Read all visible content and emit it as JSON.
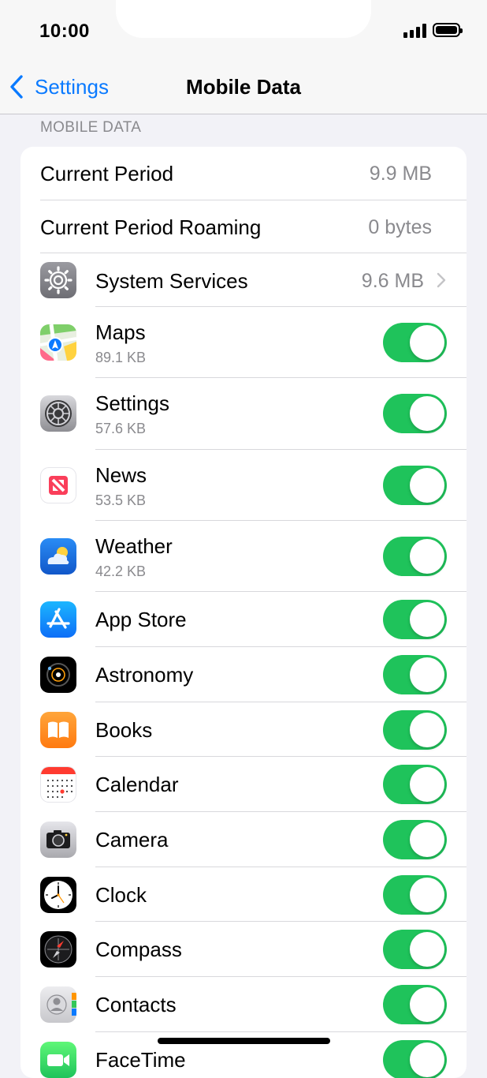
{
  "status_bar": {
    "time": "10:00"
  },
  "nav": {
    "back_label": "Settings",
    "title": "Mobile Data"
  },
  "section_header": "MOBILE DATA",
  "summary": {
    "current_period_label": "Current Period",
    "current_period_value": "9.9 MB",
    "roaming_label": "Current Period Roaming",
    "roaming_value": "0 bytes",
    "system_services_label": "System Services",
    "system_services_value": "9.6 MB"
  },
  "apps": [
    {
      "name": "Maps",
      "usage": "89.1 KB",
      "icon": "maps-icon",
      "enabled": true
    },
    {
      "name": "Settings",
      "usage": "57.6 KB",
      "icon": "settings-icon",
      "enabled": true
    },
    {
      "name": "News",
      "usage": "53.5 KB",
      "icon": "news-icon",
      "enabled": true
    },
    {
      "name": "Weather",
      "usage": "42.2 KB",
      "icon": "weather-icon",
      "enabled": true
    },
    {
      "name": "App Store",
      "usage": "",
      "icon": "app-store-icon",
      "enabled": true
    },
    {
      "name": "Astronomy",
      "usage": "",
      "icon": "astronomy-icon",
      "enabled": true
    },
    {
      "name": "Books",
      "usage": "",
      "icon": "books-icon",
      "enabled": true
    },
    {
      "name": "Calendar",
      "usage": "",
      "icon": "calendar-icon",
      "enabled": true
    },
    {
      "name": "Camera",
      "usage": "",
      "icon": "camera-icon",
      "enabled": true
    },
    {
      "name": "Clock",
      "usage": "",
      "icon": "clock-icon",
      "enabled": true
    },
    {
      "name": "Compass",
      "usage": "",
      "icon": "compass-icon",
      "enabled": true
    },
    {
      "name": "Contacts",
      "usage": "",
      "icon": "contacts-icon",
      "enabled": true
    },
    {
      "name": "FaceTime",
      "usage": "",
      "icon": "facetime-icon",
      "enabled": true
    }
  ],
  "colors": {
    "accent": "#0a7aff",
    "toggle_on": "#1fc35b",
    "secondary_text": "#8a8a8e"
  }
}
